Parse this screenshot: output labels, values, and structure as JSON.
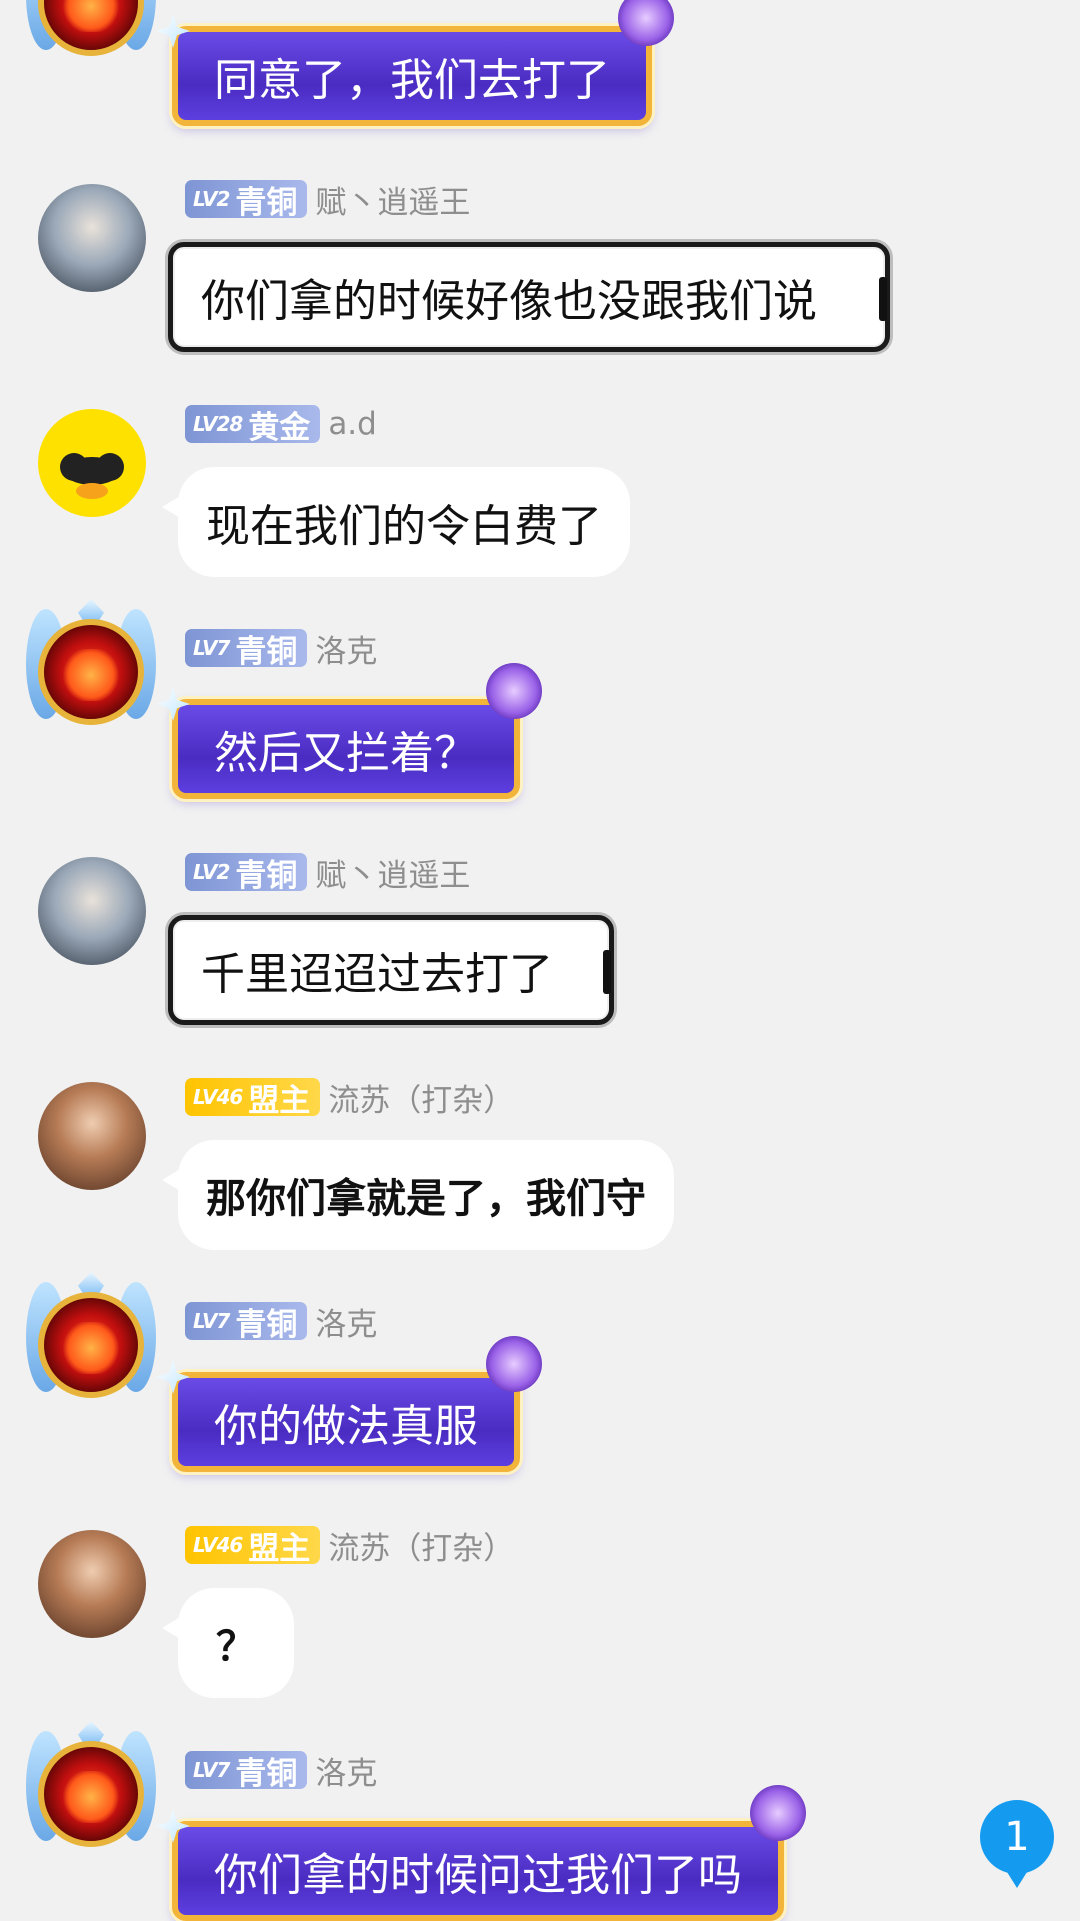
{
  "messages": [
    {
      "level": "",
      "rank": "",
      "name": "",
      "text": "同意了，我们去打了"
    },
    {
      "level": "LV2",
      "rank": "青铜",
      "name": "赋丶逍遥王",
      "text": "你们拿的时候好像也没跟我们说"
    },
    {
      "level": "LV28",
      "rank": "黄金",
      "name": "a.d",
      "text": "现在我们的令白费了"
    },
    {
      "level": "LV7",
      "rank": "青铜",
      "name": "洛克",
      "text": "然后又拦着？"
    },
    {
      "level": "LV2",
      "rank": "青铜",
      "name": "赋丶逍遥王",
      "text": "千里迢迢过去打了"
    },
    {
      "level": "LV46",
      "rank": "盟主",
      "name": "流苏（打杂）",
      "text": "那你们拿就是了，我们守"
    },
    {
      "level": "LV7",
      "rank": "青铜",
      "name": "洛克",
      "text": "你的做法真服"
    },
    {
      "level": "LV46",
      "rank": "盟主",
      "name": "流苏（打杂）",
      "text": "？"
    },
    {
      "level": "LV7",
      "rank": "青铜",
      "name": "洛克",
      "text": "你们拿的时候问过我们了吗"
    }
  ],
  "unread_count": "1",
  "colors": {
    "royal_bubble": "#4a2cc2",
    "leader_badge": "#ffc400",
    "bronze_badge": "#8a9fdd",
    "unread": "#149bf0"
  }
}
